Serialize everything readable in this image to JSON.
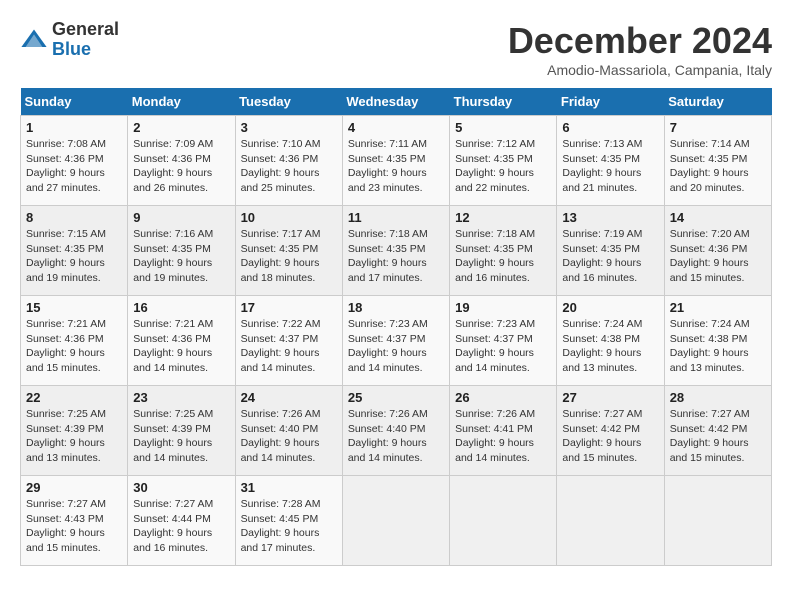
{
  "logo": {
    "general": "General",
    "blue": "Blue"
  },
  "title": "December 2024",
  "location": "Amodio-Massariola, Campania, Italy",
  "days_of_week": [
    "Sunday",
    "Monday",
    "Tuesday",
    "Wednesday",
    "Thursday",
    "Friday",
    "Saturday"
  ],
  "weeks": [
    [
      {
        "day": "1",
        "sunrise": "7:08 AM",
        "sunset": "4:36 PM",
        "daylight": "9 hours and 27 minutes."
      },
      {
        "day": "2",
        "sunrise": "7:09 AM",
        "sunset": "4:36 PM",
        "daylight": "9 hours and 26 minutes."
      },
      {
        "day": "3",
        "sunrise": "7:10 AM",
        "sunset": "4:36 PM",
        "daylight": "9 hours and 25 minutes."
      },
      {
        "day": "4",
        "sunrise": "7:11 AM",
        "sunset": "4:35 PM",
        "daylight": "9 hours and 23 minutes."
      },
      {
        "day": "5",
        "sunrise": "7:12 AM",
        "sunset": "4:35 PM",
        "daylight": "9 hours and 22 minutes."
      },
      {
        "day": "6",
        "sunrise": "7:13 AM",
        "sunset": "4:35 PM",
        "daylight": "9 hours and 21 minutes."
      },
      {
        "day": "7",
        "sunrise": "7:14 AM",
        "sunset": "4:35 PM",
        "daylight": "9 hours and 20 minutes."
      }
    ],
    [
      {
        "day": "8",
        "sunrise": "7:15 AM",
        "sunset": "4:35 PM",
        "daylight": "9 hours and 19 minutes."
      },
      {
        "day": "9",
        "sunrise": "7:16 AM",
        "sunset": "4:35 PM",
        "daylight": "9 hours and 19 minutes."
      },
      {
        "day": "10",
        "sunrise": "7:17 AM",
        "sunset": "4:35 PM",
        "daylight": "9 hours and 18 minutes."
      },
      {
        "day": "11",
        "sunrise": "7:18 AM",
        "sunset": "4:35 PM",
        "daylight": "9 hours and 17 minutes."
      },
      {
        "day": "12",
        "sunrise": "7:18 AM",
        "sunset": "4:35 PM",
        "daylight": "9 hours and 16 minutes."
      },
      {
        "day": "13",
        "sunrise": "7:19 AM",
        "sunset": "4:35 PM",
        "daylight": "9 hours and 16 minutes."
      },
      {
        "day": "14",
        "sunrise": "7:20 AM",
        "sunset": "4:36 PM",
        "daylight": "9 hours and 15 minutes."
      }
    ],
    [
      {
        "day": "15",
        "sunrise": "7:21 AM",
        "sunset": "4:36 PM",
        "daylight": "9 hours and 15 minutes."
      },
      {
        "day": "16",
        "sunrise": "7:21 AM",
        "sunset": "4:36 PM",
        "daylight": "9 hours and 14 minutes."
      },
      {
        "day": "17",
        "sunrise": "7:22 AM",
        "sunset": "4:37 PM",
        "daylight": "9 hours and 14 minutes."
      },
      {
        "day": "18",
        "sunrise": "7:23 AM",
        "sunset": "4:37 PM",
        "daylight": "9 hours and 14 minutes."
      },
      {
        "day": "19",
        "sunrise": "7:23 AM",
        "sunset": "4:37 PM",
        "daylight": "9 hours and 14 minutes."
      },
      {
        "day": "20",
        "sunrise": "7:24 AM",
        "sunset": "4:38 PM",
        "daylight": "9 hours and 13 minutes."
      },
      {
        "day": "21",
        "sunrise": "7:24 AM",
        "sunset": "4:38 PM",
        "daylight": "9 hours and 13 minutes."
      }
    ],
    [
      {
        "day": "22",
        "sunrise": "7:25 AM",
        "sunset": "4:39 PM",
        "daylight": "9 hours and 13 minutes."
      },
      {
        "day": "23",
        "sunrise": "7:25 AM",
        "sunset": "4:39 PM",
        "daylight": "9 hours and 14 minutes."
      },
      {
        "day": "24",
        "sunrise": "7:26 AM",
        "sunset": "4:40 PM",
        "daylight": "9 hours and 14 minutes."
      },
      {
        "day": "25",
        "sunrise": "7:26 AM",
        "sunset": "4:40 PM",
        "daylight": "9 hours and 14 minutes."
      },
      {
        "day": "26",
        "sunrise": "7:26 AM",
        "sunset": "4:41 PM",
        "daylight": "9 hours and 14 minutes."
      },
      {
        "day": "27",
        "sunrise": "7:27 AM",
        "sunset": "4:42 PM",
        "daylight": "9 hours and 15 minutes."
      },
      {
        "day": "28",
        "sunrise": "7:27 AM",
        "sunset": "4:42 PM",
        "daylight": "9 hours and 15 minutes."
      }
    ],
    [
      {
        "day": "29",
        "sunrise": "7:27 AM",
        "sunset": "4:43 PM",
        "daylight": "9 hours and 15 minutes."
      },
      {
        "day": "30",
        "sunrise": "7:27 AM",
        "sunset": "4:44 PM",
        "daylight": "9 hours and 16 minutes."
      },
      {
        "day": "31",
        "sunrise": "7:28 AM",
        "sunset": "4:45 PM",
        "daylight": "9 hours and 17 minutes."
      },
      null,
      null,
      null,
      null
    ]
  ]
}
